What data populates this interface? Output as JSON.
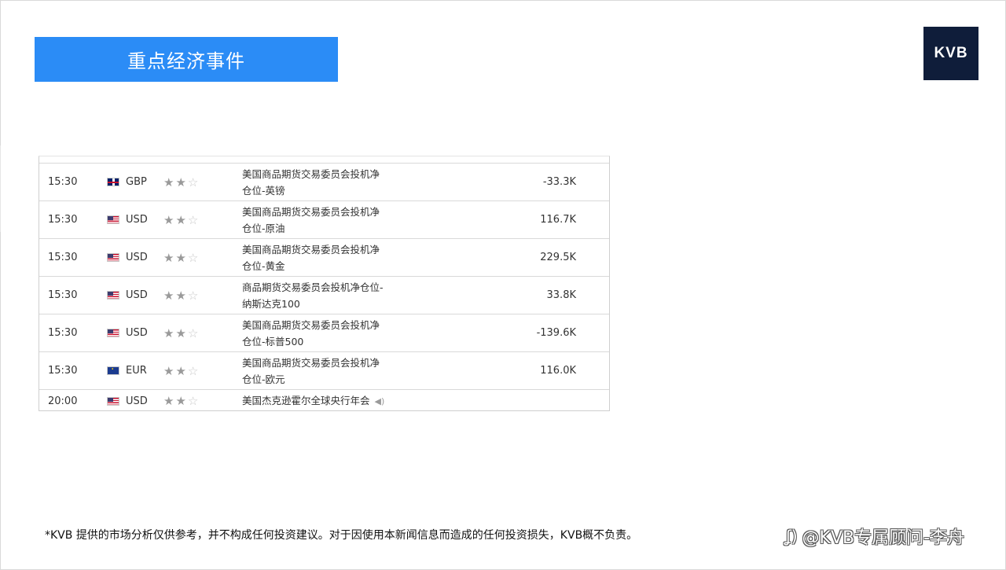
{
  "header": {
    "title": "重点经济事件",
    "logo_text": "KVB"
  },
  "events": [
    {
      "time": "15:30",
      "flag_icon": "uk-flag-icon",
      "currency": "GBP",
      "stars_filled": 2,
      "stars_total": 3,
      "event_line1": "美国商品期货交易委员会投机净",
      "event_line2": "仓位-英镑",
      "value": "-33.3K"
    },
    {
      "time": "15:30",
      "flag_icon": "us-flag-icon",
      "currency": "USD",
      "stars_filled": 2,
      "stars_total": 3,
      "event_line1": "美国商品期货交易委员会投机净",
      "event_line2": "仓位-原油",
      "value": "116.7K"
    },
    {
      "time": "15:30",
      "flag_icon": "us-flag-icon",
      "currency": "USD",
      "stars_filled": 2,
      "stars_total": 3,
      "event_line1": "美国商品期货交易委员会投机净",
      "event_line2": "仓位-黄金",
      "value": "229.5K"
    },
    {
      "time": "15:30",
      "flag_icon": "us-flag-icon",
      "currency": "USD",
      "stars_filled": 2,
      "stars_total": 3,
      "event_line1": "商品期货交易委员会投机净仓位-",
      "event_line2": "纳斯达克100",
      "value": "33.8K"
    },
    {
      "time": "15:30",
      "flag_icon": "us-flag-icon",
      "currency": "USD",
      "stars_filled": 2,
      "stars_total": 3,
      "event_line1": "美国商品期货交易委员会投机净",
      "event_line2": "仓位-标普500",
      "value": "-139.6K"
    },
    {
      "time": "15:30",
      "flag_icon": "eu-flag-icon",
      "currency": "EUR",
      "stars_filled": 2,
      "stars_total": 3,
      "event_line1": "美国商品期货交易委员会投机净",
      "event_line2": "仓位-欧元",
      "value": "116.0K"
    },
    {
      "time": "20:00",
      "flag_icon": "us-flag-icon",
      "currency": "USD",
      "stars_filled": 2,
      "stars_total": 3,
      "event_line1": "美国杰克逊霍尔全球央行年会",
      "event_line2": "",
      "value": "",
      "has_speaker_icon": true
    }
  ],
  "footer": {
    "disclaimer": "*KVB 提供的市场分析仅供参考，并不构成任何投资建议。对于因使用本新闻信息而造成的任何投资损失，KVB概不负责。",
    "watermark": "@KVB专属顾问-李舟"
  }
}
